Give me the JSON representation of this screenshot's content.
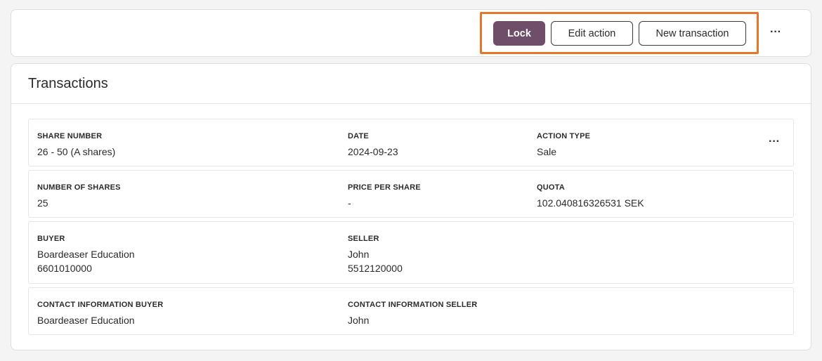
{
  "toolbar": {
    "lock_label": "Lock",
    "edit_label": "Edit action",
    "new_label": "New transaction",
    "more_label": "···"
  },
  "transactions": {
    "title": "Transactions",
    "more_label": "···",
    "share_number": {
      "label": "SHARE NUMBER",
      "value": "26 - 50 (A shares)"
    },
    "date": {
      "label": "DATE",
      "value": "2024-09-23"
    },
    "action_type": {
      "label": "ACTION TYPE",
      "value": "Sale"
    },
    "number_of_shares": {
      "label": "NUMBER OF SHARES",
      "value": "25"
    },
    "price_per_share": {
      "label": "PRICE PER SHARE",
      "value": "-"
    },
    "quota": {
      "label": "QUOTA",
      "value": "102.040816326531 SEK"
    },
    "buyer": {
      "label": "BUYER",
      "name": "Boardeaser Education",
      "id": "6601010000"
    },
    "seller": {
      "label": "SELLER",
      "name": "John",
      "id": "5512120000"
    },
    "contact_buyer": {
      "label": "CONTACT INFORMATION BUYER",
      "value": "Boardeaser Education"
    },
    "contact_seller": {
      "label": "CONTACT INFORMATION SELLER",
      "value": "John"
    }
  },
  "colors": {
    "primary": "#6e4e68",
    "highlight": "#e7762d",
    "border": "#dedede"
  }
}
